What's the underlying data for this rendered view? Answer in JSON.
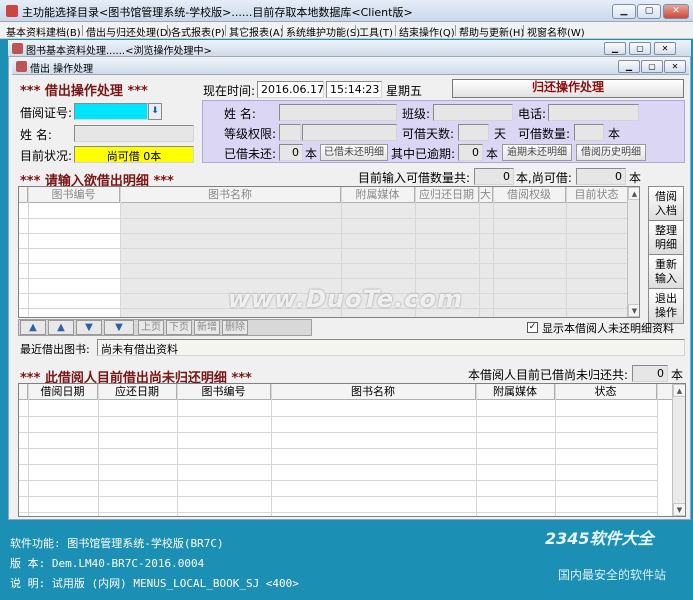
{
  "window": {
    "title": "主功能选择目录<图书馆管理系统-学校版>......目前存取本地数据库<Client版>",
    "controls": [
      "▁",
      "▢",
      "✕"
    ]
  },
  "menu": [
    "基本资料建档(B)",
    "借出与归还处理(D)",
    "各式报表(P)",
    "其它报表(A)",
    "系统维护功能(S)",
    "工具(T)",
    "结束操作(Q)",
    "帮助与更新(H)",
    "视窗名称(W)"
  ],
  "child1": {
    "title": "图书基本资料处理......<浏览操作处理中>"
  },
  "child2": {
    "title": "借出 操作处理"
  },
  "header": {
    "section_title": "***  借出操作处理  ***",
    "now_label": "现在时间:",
    "date": "2016.06.17",
    "time": "15:14:23",
    "weekday": "星期五",
    "return_button": "归还操作处理"
  },
  "borrower": {
    "card_label": "借阅证号:",
    "card_value": "",
    "name_label": "姓      名:",
    "name_value": "",
    "status_label": "目前状况:",
    "status_value": "尚可借      0本"
  },
  "info": {
    "name_label": "姓      名:",
    "class_label": "班级:",
    "phone_label": "电话:",
    "level_label": "等级权限:",
    "days_label": "可借天数:",
    "days_unit": "天",
    "qty_label": "可借数量:",
    "qty_unit": "本",
    "unreturned_label": "已借未还:",
    "unreturned_value": "0",
    "unreturned_unit": "本",
    "unreturned_btn": "已借未还明细",
    "overdue_label": "其中已逾期:",
    "overdue_value": "0",
    "overdue_unit": "本",
    "overdue_btn": "逾期未还明细",
    "history_btn": "借阅历史明细"
  },
  "borrow_section": {
    "title": "***  请输入欲借出明细  ***",
    "count_label": "目前输入可借数量共:",
    "count_value": "0",
    "count_unit": "本,尚可借:",
    "remain_value": "0",
    "remain_unit": "本",
    "columns": [
      "图书编号",
      "图书名称",
      "附属媒体",
      "应归还日期",
      "大",
      "借阅权级",
      "目前状态"
    ]
  },
  "side_buttons": [
    {
      "line1": "借阅",
      "line2": "入档"
    },
    {
      "line1": "整理",
      "line2": "明细"
    },
    {
      "line1": "重新",
      "line2": "输入"
    },
    {
      "line1": "退出",
      "line2": "操作"
    }
  ],
  "nav": {
    "first": "▲",
    "prev": "▲",
    "next": "▼",
    "last": "▼",
    "prev_page": "上页",
    "next_page": "下页",
    "add": "新增",
    "delete": "删除",
    "show_unreturned_label": "显示本借阅人未还明细资料",
    "show_unreturned_checked": "✓"
  },
  "recent": {
    "label": "最近借出图书:",
    "value": "尚未有借出资料"
  },
  "unreturned_section": {
    "title": "***  此借阅人目前借出尚未归还明细  ***",
    "count_label": "本借阅人目前已借尚未归还共:",
    "count_value": "0",
    "count_unit": "本",
    "columns": [
      "借阅日期",
      "应还日期",
      "图书编号",
      "图书名称",
      "附属媒体",
      "状态"
    ]
  },
  "status": {
    "function_label": "软件功能: 图书馆管理系统-学校版(BR7C)",
    "version_label": "版      本: Dem.LM40-BR7C-2016.0004",
    "note_label": "说      明: 试用版 (内网) MENUS_LOCAL_BOOK_SJ <400>"
  },
  "watermarks": {
    "center": "www.DuoTe.com",
    "brand": "2345软件大全",
    "brand_sub": "国内最安全的软件站"
  },
  "colors": {
    "accent_blue": "#1c8fb5",
    "title_red": "#7a1515",
    "card_field": "#00e5ff",
    "status_field": "#ffff00",
    "info_panel": "#dcd6f5"
  }
}
